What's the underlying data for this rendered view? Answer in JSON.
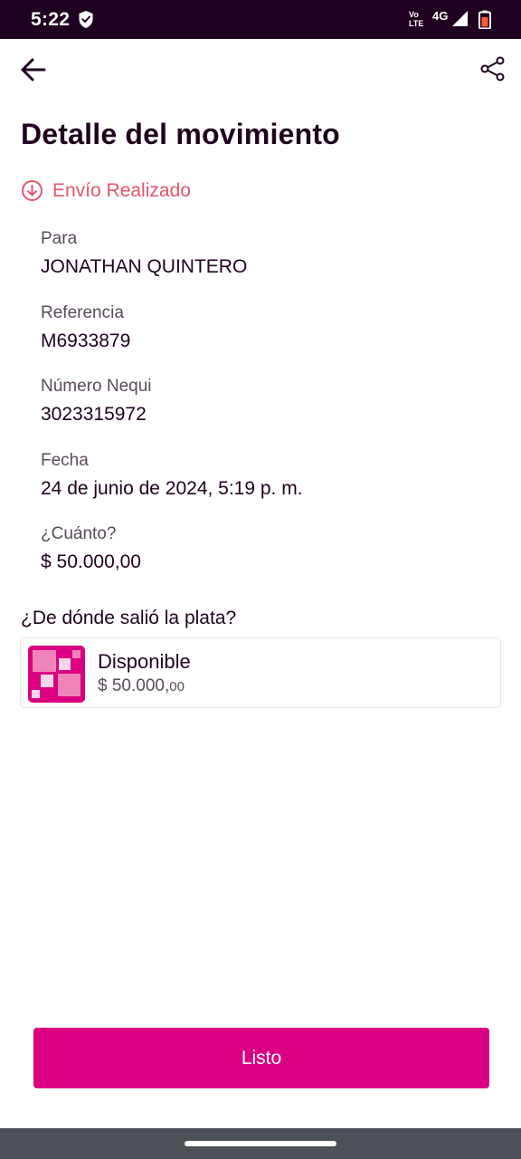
{
  "status_bar": {
    "time": "5:22",
    "volte_top": "Vo",
    "volte_bottom": "LTE",
    "network": "4G"
  },
  "header": {
    "title": "Detalle del movimiento"
  },
  "status": {
    "label": "Envío Realizado",
    "color": "#e5566b"
  },
  "details": [
    {
      "label": "Para",
      "value": "JONATHAN QUINTERO"
    },
    {
      "label": "Referencia",
      "value": "M6933879"
    },
    {
      "label": "Número Nequi",
      "value": "3023315972"
    },
    {
      "label": "Fecha",
      "value": "24 de junio de 2024, 5:19 p. m."
    },
    {
      "label": "¿Cuánto?",
      "value": "$ 50.000,00"
    }
  ],
  "source": {
    "question": "¿De dónde salió la plata?",
    "name": "Disponible",
    "amount_main": "$ 50.000,",
    "amount_cents": "00"
  },
  "action": {
    "button_label": "Listo",
    "color": "#da0081"
  },
  "icons": {
    "back": "back-arrow-icon",
    "share": "share-icon",
    "status": "arrow-down-circle-icon",
    "source": "nequi-pocket-icon"
  }
}
